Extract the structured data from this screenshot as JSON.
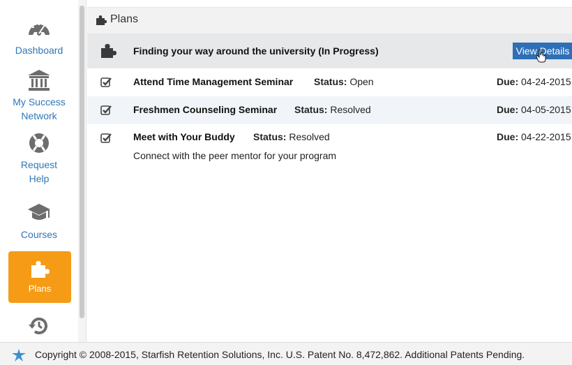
{
  "sidebar": {
    "items": [
      {
        "label": "Dashboard",
        "icon": "dashboard-gauge-icon"
      },
      {
        "label": "My Success\nNetwork",
        "icon": "bank-building-icon"
      },
      {
        "label": "Request\nHelp",
        "icon": "lifebuoy-icon"
      },
      {
        "label": "Courses",
        "icon": "graduation-cap-icon"
      },
      {
        "label": "Plans",
        "icon": "puzzle-icon"
      },
      {
        "label": "",
        "icon": "history-icon"
      }
    ],
    "active": "Plans"
  },
  "header": {
    "title": "Plans"
  },
  "plan": {
    "title": "Finding your way around the university (In Progress)",
    "button_label": "View Details"
  },
  "tasks": [
    {
      "name": "Attend Time Management Seminar",
      "status_label": "Status:",
      "status": "Open",
      "due_label": "Due:",
      "due": "04-24-2015"
    },
    {
      "name": "Freshmen Counseling Seminar",
      "status_label": "Status:",
      "status": "Resolved",
      "due_label": "Due:",
      "due": "04-05-2015"
    },
    {
      "name": "Meet with Your Buddy",
      "status_label": "Status:",
      "status": "Resolved",
      "due_label": "Due:",
      "due": "04-22-2015",
      "description": "Connect with the peer mentor for your program"
    }
  ],
  "footer": {
    "copyright": "Copyright © 2008-2015, Starfish Retention Solutions, Inc. U.S. Patent No. 8,472,862. Additional Patents Pending."
  },
  "colors": {
    "accent_blue": "#2e77b8",
    "active_orange": "#f59b16",
    "button_blue": "#2e6fb6",
    "icon_gray": "#6a6a6a"
  }
}
